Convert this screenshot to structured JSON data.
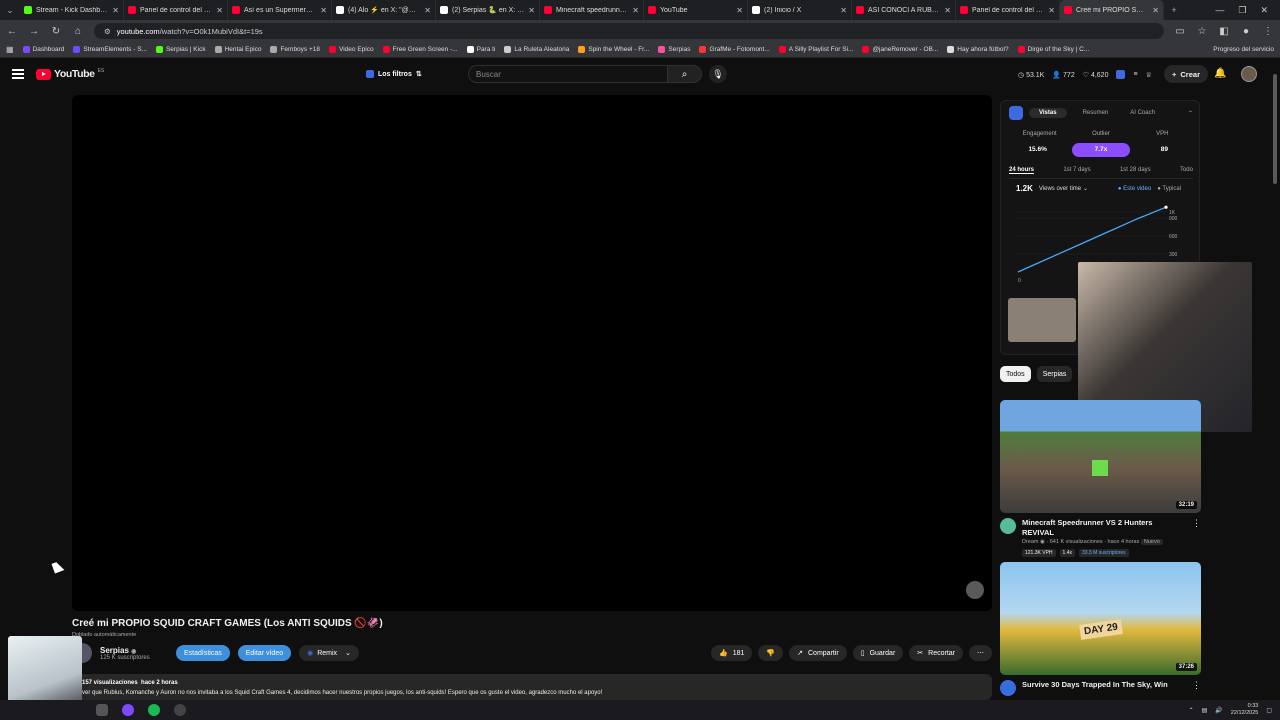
{
  "browser": {
    "tabs": [
      {
        "title": "Stream - Kick Dashboard",
        "color": "#53fc18"
      },
      {
        "title": "Panel de control del canal",
        "color": "#ff0033"
      },
      {
        "title": "Así es un Supermercado en...",
        "color": "#ff0033"
      },
      {
        "title": "(4) Alo ⚡ en X: \"@Serpias\"",
        "color": "#ffffff"
      },
      {
        "title": "(2) Serpias 🐍 en X: \"Cre...\"",
        "color": "#ffffff"
      },
      {
        "title": "Minecraft speedrunner VS...",
        "color": "#ff0033"
      },
      {
        "title": "YouTube",
        "color": "#ff0033"
      },
      {
        "title": "(2) Inicio / X",
        "color": "#ffffff"
      },
      {
        "title": "ASI CONOCI A RUBIUS Y A...",
        "color": "#ff0033"
      },
      {
        "title": "Panel de control del canal",
        "color": "#ff0033"
      },
      {
        "title": "Creé mi PROPIO SQUID C...",
        "color": "#ff0033",
        "active": true
      }
    ],
    "url_host": "youtube.com",
    "url_rest": "/watch?v=O0k1MubiVdI&t=19s",
    "bookmarks": [
      {
        "label": "Dashboard",
        "color": "#7b4bff"
      },
      {
        "label": "StreamElements - S...",
        "color": "#6a4dff"
      },
      {
        "label": "Serpias | Kick",
        "color": "#53fc18"
      },
      {
        "label": "Hentai Epico",
        "color": "#aaaaaa"
      },
      {
        "label": "Femboys +18",
        "color": "#aaaaaa"
      },
      {
        "label": "Video Epico",
        "color": "#ff0033"
      },
      {
        "label": "Free Green Screen -...",
        "color": "#ff0033"
      },
      {
        "label": "Para ti",
        "color": "#ffffff"
      },
      {
        "label": "La Ruleta Aleatoria",
        "color": "#cccccc"
      },
      {
        "label": "Spin the Wheel - Fr...",
        "color": "#ff9f1a"
      },
      {
        "label": "Serpias",
        "color": "#ff4fa0"
      },
      {
        "label": "GrafMe - Fotomont...",
        "color": "#ff3333"
      },
      {
        "label": "A Silly Playlist For Si...",
        "color": "#ff0033"
      },
      {
        "label": "@janeRemover - OB...",
        "color": "#ff0033"
      },
      {
        "label": "Hay ahora fútbol?",
        "color": "#dddddd"
      },
      {
        "label": "Dirge of the Sky | C...",
        "color": "#ff0033"
      }
    ],
    "bookmarks_right": "Progreso del servicio"
  },
  "yt_header": {
    "logo_text": "YouTube",
    "logo_sup": "ES",
    "filters_label": "Los filtros",
    "search_placeholder": "Buscar",
    "stat_views": "53.1K",
    "stat_subs": "772",
    "stat_likes": "4,620",
    "create_label": "Crear"
  },
  "video": {
    "title": "Creé mi PROPIO SQUID CRAFT GAMES (Los ANTI SQUIDS 🚫🦑)",
    "dub_note": "Doblado automáticamente",
    "channel_name": "Serpias",
    "channel_subs": "125 K suscriptores",
    "btn_stats": "Estadísticas",
    "btn_edit": "Editar vídeo",
    "btn_remix": "Remix",
    "likes": "181",
    "btn_share": "Compartir",
    "btn_save": "Guardar",
    "btn_clip": "Recortar",
    "views": "157 visualizaciones",
    "age": "hace 2 horas",
    "description": "ver que Rubius, Komanche y Auron no nos invitaba a los Squid Craft Games 4, decidimos hacer nuestros propios juegos, los anti-squids! Espero que os guste el video, agradezco mucho el apoyo!"
  },
  "extension": {
    "tabs": [
      "Vistas",
      "Resumen",
      "AI Coach"
    ],
    "metric_labels": [
      "Engagement",
      "Outlier",
      "VPH"
    ],
    "metric_values": [
      "15.6%",
      "7.7x",
      "89"
    ],
    "periods": [
      "24 hours",
      "1st 7 days",
      "1st 28 days",
      "Todo"
    ],
    "total": "1.2K",
    "dropdown": "Views over time",
    "legend": [
      "Este video",
      "Typical"
    ],
    "y_ticks": [
      "1K",
      "900",
      "600",
      "300"
    ],
    "x_ticks": [
      "0",
      "1H"
    ]
  },
  "chart_data": {
    "type": "line",
    "x": [
      0,
      0.2,
      0.4,
      0.6,
      0.8,
      1.0,
      1.2,
      1.4,
      1.6,
      1.8,
      2.0
    ],
    "series": [
      {
        "name": "Este video",
        "values": [
          0,
          110,
          220,
          330,
          440,
          550,
          660,
          770,
          880,
          980,
          1080
        ]
      }
    ],
    "ylabel": "",
    "xlabel": "",
    "ylim": [
      0,
      1100
    ]
  },
  "side_chips": [
    "Todos",
    "Serpias"
  ],
  "recommendations": [
    {
      "title": "Minecraft Speedrunner VS 2 Hunters REVIVAL",
      "channel": "Dream",
      "meta": "641 K visualizaciones · hace 4 horas",
      "badge_new": "Nuevo",
      "duration": "32:19",
      "vph": "121.3K VPH",
      "outlier": "1.4x",
      "subs": "33.3 M suscriptores"
    },
    {
      "title": "Survive 30 Days Trapped In The Sky, Win",
      "duration": "37:26"
    }
  ],
  "taskbar": {
    "time": "0:33",
    "date": "22/12/2025"
  }
}
